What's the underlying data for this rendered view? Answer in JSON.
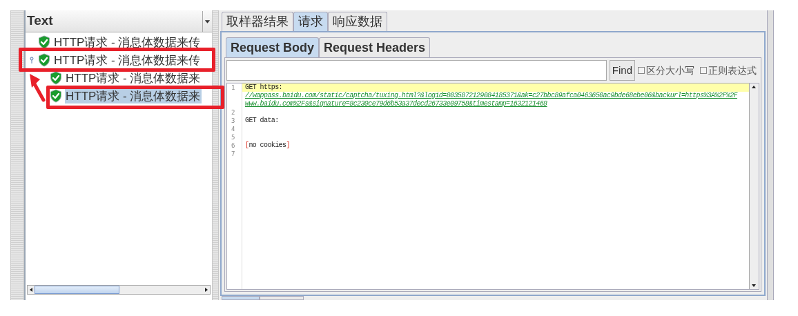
{
  "tree_header": {
    "label": "Text"
  },
  "tree": [
    {
      "label": "HTTP请求 - 消息体数据来传",
      "selected": false
    },
    {
      "label": "HTTP请求 - 消息体数据来传",
      "selected": false,
      "expanded": true,
      "children": [
        {
          "label": "HTTP请求 - 消息体数据来",
          "selected": false
        },
        {
          "label": "HTTP请求 - 消息体数据来",
          "selected": true
        }
      ]
    }
  ],
  "tabs": [
    {
      "label": "取样器结果",
      "selected": false
    },
    {
      "label": "请求",
      "selected": true
    },
    {
      "label": "响应数据",
      "selected": false
    }
  ],
  "sub_tabs": [
    {
      "label": "Request Body",
      "selected": true
    },
    {
      "label": "Request Headers",
      "selected": false
    }
  ],
  "search": {
    "button": "Find",
    "options": [
      {
        "label": "区分大小写",
        "checked": false
      },
      {
        "label": "正则表达式",
        "checked": false
      }
    ]
  },
  "code_lines": [
    {
      "number": "1",
      "highlighted": true,
      "segments": [
        {
          "kind": "plain",
          "text": "GET https:"
        }
      ],
      "link_rows": [
        "//wappass.baidu.com/static/captcha/tuxing.html?&logid=8035872129084185371&ak=c27bbc89afca0463650ac9bde68ebe06&backurl=https%3A%2F%2F",
        "www.baidu.com%2Fs&signature=8c230ce79d6b53a37decd26733e09758&timestamp=1632121468"
      ]
    },
    {
      "number": "2"
    },
    {
      "number": "3",
      "segments": [
        {
          "kind": "plain",
          "text": "GET data:"
        }
      ]
    },
    {
      "number": "4"
    },
    {
      "number": "5"
    },
    {
      "number": "6",
      "segments": [
        {
          "kind": "bracket",
          "text": "["
        },
        {
          "kind": "plain",
          "text": "no cookies"
        },
        {
          "kind": "bracket",
          "text": "]"
        }
      ]
    },
    {
      "number": "7"
    }
  ]
}
